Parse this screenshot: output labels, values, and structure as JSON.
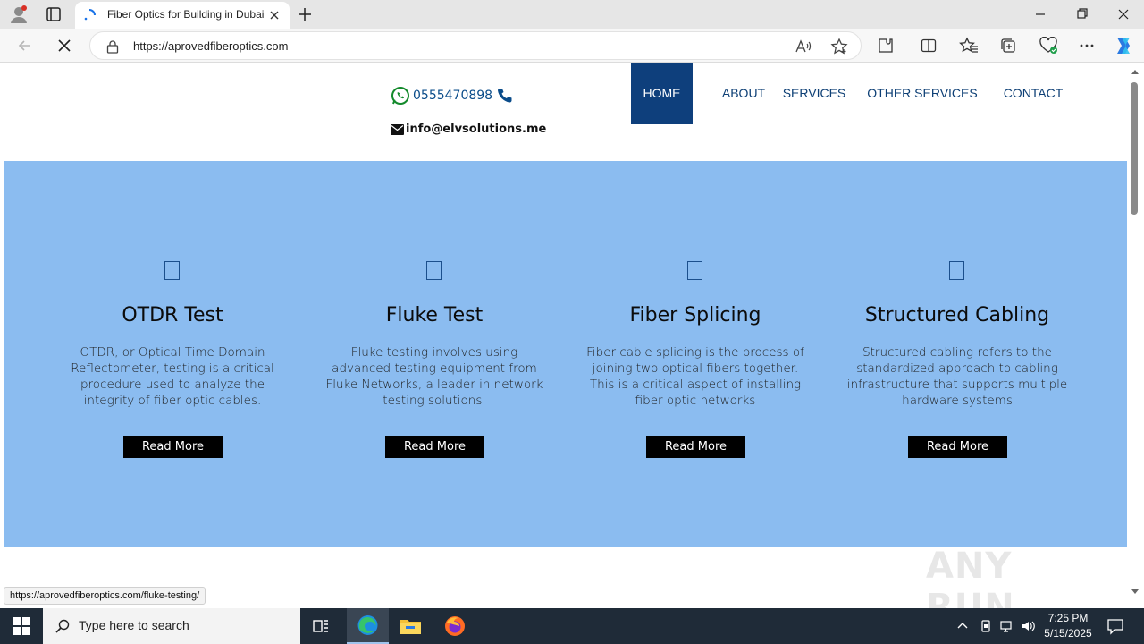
{
  "browser": {
    "tab": {
      "title": "Fiber Optics for Building in Dubai"
    },
    "address_bar": {
      "url": "https://aprovedfiberoptics.com"
    },
    "status_url": "https://aprovedfiberoptics.com/fluke-testing/"
  },
  "site": {
    "contact": {
      "phone": "0555470898",
      "email": "info@elvsolutions.me"
    },
    "menu": [
      {
        "label": "HOME",
        "active": true
      },
      {
        "label": "ABOUT"
      },
      {
        "label": "SERVICES"
      },
      {
        "label": "OTHER SERVICES"
      },
      {
        "label": "CONTACT"
      }
    ],
    "services": [
      {
        "title": "OTDR Test",
        "text": "OTDR, or Optical Time Domain Reflectometer, testing is a critical procedure used to analyze the integrity of fiber optic cables.",
        "button": "Read More"
      },
      {
        "title": "Fluke Test",
        "text": "Fluke testing involves using advanced testing equipment from Fluke Networks, a leader in network testing solutions.",
        "button": "Read More"
      },
      {
        "title": "Fiber Splicing",
        "text": "Fiber cable splicing is the process of joining two optical fibers together. This is a critical aspect of installing fiber optic networks",
        "button": "Read More"
      },
      {
        "title": "Structured Cabling",
        "text": "Structured cabling refers to the standardized approach to cabling infrastructure that supports multiple hardware systems",
        "button": "Read More"
      }
    ],
    "watermark": "ANY RUN",
    "colors": {
      "hero_bg": "#8bbcf0",
      "menu_active_bg": "#0e3f7c",
      "menu_text": "#0d3f75",
      "button_bg": "#000000"
    }
  },
  "taskbar": {
    "search_placeholder": "Type here to search",
    "time": "7:25 PM",
    "date": "5/15/2025"
  }
}
